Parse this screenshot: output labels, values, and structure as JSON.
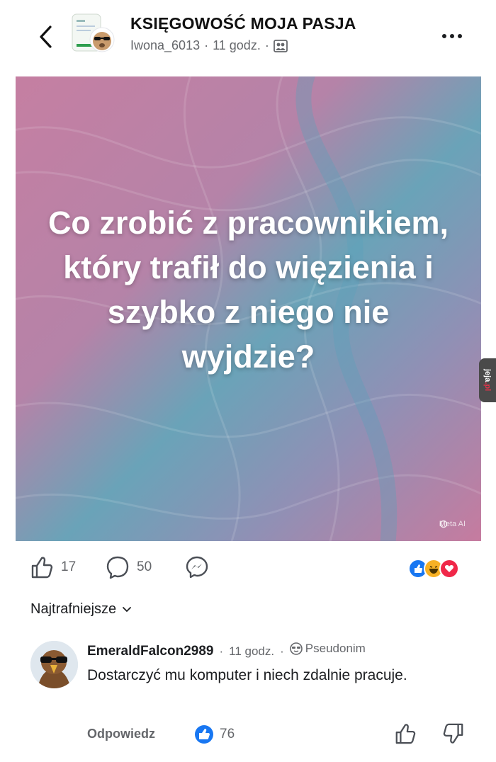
{
  "header": {
    "group_name": "KSIĘGOWOŚĆ MOJA PASJA",
    "author": "Iwona_6013",
    "time": "11 godz.",
    "sep": "·",
    "visibility_icon": "group-members-icon"
  },
  "post": {
    "text": "Co zrobić z pracownikiem, który trafił do więzienia i szybko z niego nie wyjdzie?",
    "watermark": "Meta AI",
    "colors": {
      "pink": "#c27ea0",
      "teal": "#6fa6bd"
    }
  },
  "side_tag": {
    "prefix": "jeja",
    "suffix": ".pl"
  },
  "actions": {
    "likes": "17",
    "comments": "50",
    "share_icon": "messenger-icon",
    "reactions": [
      "like",
      "haha",
      "love"
    ]
  },
  "sort": {
    "label": "Najtrafniejsze"
  },
  "comment": {
    "author": "EmeraldFalcon2989",
    "sep": "·",
    "time": "11 godz.",
    "badge": "Pseudonim",
    "text": "Dostarczyć mu komputer i niech zdalnie pracuje.",
    "reply_label": "Odpowiedz",
    "likes": "76"
  },
  "colors": {
    "accent": "#1877f2",
    "muted": "#65676b",
    "love": "#f02849",
    "haha": "#f7b125"
  }
}
